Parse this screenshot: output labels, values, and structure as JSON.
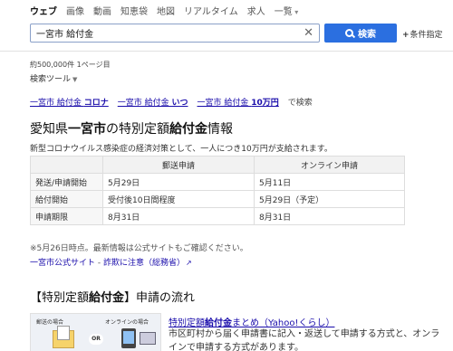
{
  "nav": {
    "tabs": [
      "ウェブ",
      "画像",
      "動画",
      "知恵袋",
      "地図",
      "リアルタイム",
      "求人"
    ],
    "more_label": "一覧"
  },
  "search": {
    "query": "一宮市 給付金",
    "button_label": "検索",
    "conditions_label": "条件指定"
  },
  "results": {
    "count_num": "約500,000件",
    "count_page": "1ページ目",
    "tools_label": "検索ツール"
  },
  "related": {
    "items": [
      {
        "base": "一宮市 給付金 ",
        "extra": "コロナ"
      },
      {
        "base": "一宮市 給付金 ",
        "extra": "いつ"
      },
      {
        "base": "一宮市 給付金 ",
        "extra": "10万円"
      }
    ],
    "suffix": "で検索"
  },
  "card": {
    "title_pre": "愛知県",
    "title_bold": "一宮市",
    "title_mid": "の特別定額",
    "title_bold2": "給付金",
    "title_post": "情報",
    "description": "新型コロナウイルス感染症の経済対策として、一人につき10万円が支給されます。",
    "table": {
      "headers": [
        "",
        "郵送申請",
        "オンライン申請"
      ],
      "rows": [
        [
          "発送/申請開始",
          "5月29日",
          "5月11日"
        ],
        [
          "給付開始",
          "受付後10日間程度",
          "5月29日（予定）"
        ],
        [
          "申請期限",
          "8月31日",
          "8月31日"
        ]
      ]
    },
    "note": "※5月26日時点。最新情報は公式サイトもご確認ください。",
    "source_site": "一宮市公式サイト",
    "source_sep": " - ",
    "source_fraud": "詐欺に注意（総務省）"
  },
  "section": {
    "title_bracket_open": "【特別定額",
    "title_bold": "給付金",
    "title_bracket_close": "】申請の流れ",
    "thumb_label_mail": "郵送の場合",
    "thumb_label_online": "オンラインの場合",
    "thumb_or": "OR",
    "link_pre": "特別定額",
    "link_bold": "給付金",
    "link_post": "まとめ（Yahoo!くらし）",
    "snippet": "市区町村から届く申請書に記入・返送して申請する方式と、オンラインで申請する方式があります。"
  }
}
